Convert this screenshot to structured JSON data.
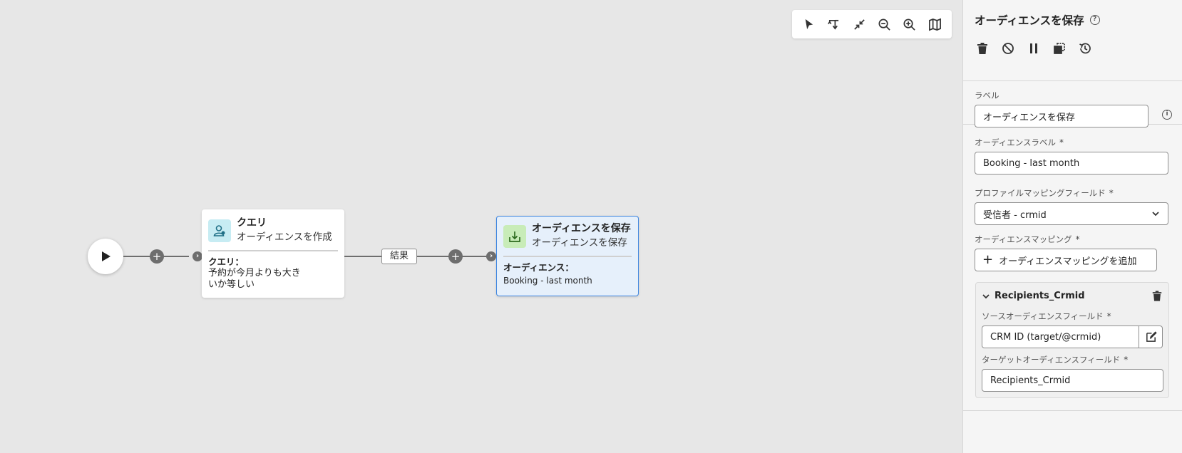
{
  "canvas": {
    "toolbar": {
      "items": [
        {
          "name": "pointer-icon"
        },
        {
          "name": "reroute-icon"
        },
        {
          "name": "collapse-icon"
        },
        {
          "name": "zoom-out-icon"
        },
        {
          "name": "zoom-in-icon"
        },
        {
          "name": "map-icon"
        }
      ]
    },
    "nodes": {
      "query": {
        "title": "クエリ",
        "subtitle": "オーディエンスを作成",
        "body_label": "クエリ：",
        "body_line1": "予約が今月よりも大き",
        "body_line2": "いか等しい",
        "icon_color": "#c7ecf3"
      },
      "result_chip": "結果",
      "save": {
        "title": "オーディエンスを保存",
        "subtitle": "オーディエンスを保存",
        "body_label": "オーディエンス：",
        "body_value": "Booking - last month",
        "icon_color": "#c8ecb8",
        "selected_bg": "#e6f0fb",
        "selected_border": "#3f86e0"
      }
    }
  },
  "panel": {
    "title": "オーディエンスを保存",
    "label_label": "ラベル",
    "label_value": "オーディエンスを保存",
    "audience_label_label": "オーディエンスラベル",
    "audience_label_value": "Booking - last month",
    "profile_mapping_label": "プロファイルマッピングフィールド",
    "profile_mapping_value": "受信者 - crmid",
    "audience_mapping_label": "オーディエンスマッピング",
    "add_mapping_label": "オーディエンスマッピングを追加",
    "required_mark": "*",
    "mapping": {
      "name": "Recipients_Crmid",
      "source_label": "ソースオーディエンスフィールド",
      "source_value": "CRM ID (target/@crmid)",
      "target_label": "ターゲットオーディエンスフィールド",
      "target_value": "Recipients_Crmid"
    }
  }
}
